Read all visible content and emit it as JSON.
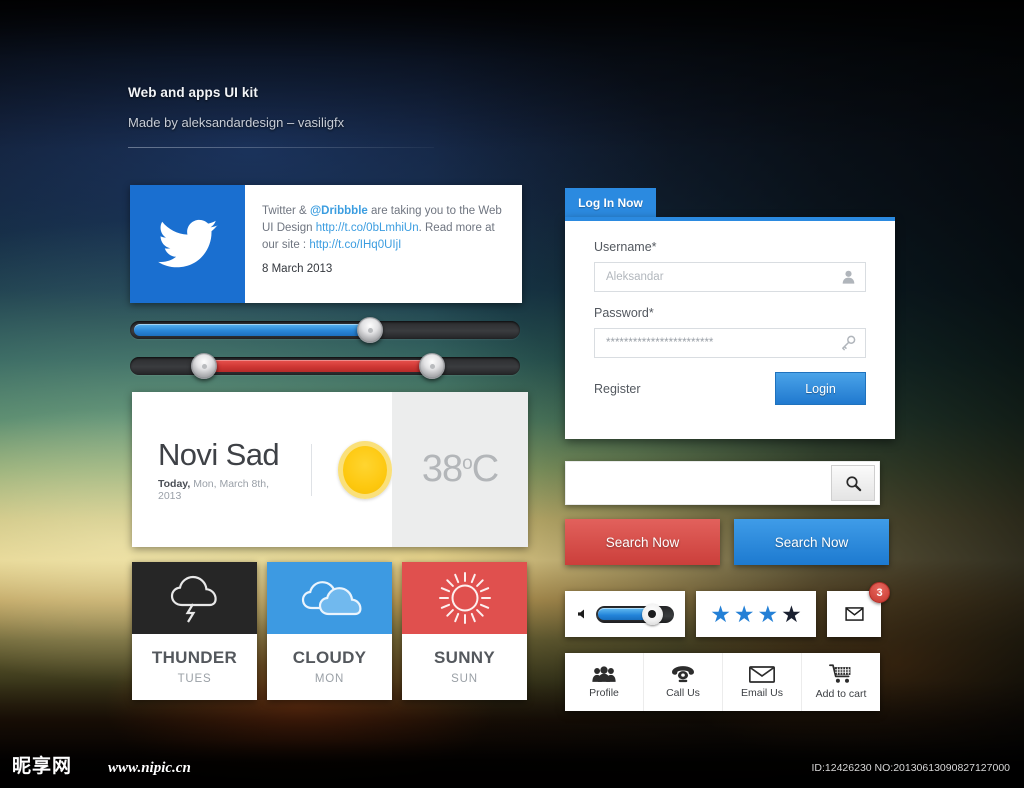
{
  "header": {
    "title": "Web and apps UI kit",
    "subtitle": "Made by aleksandardesign – vasiligfx"
  },
  "twitter_card": {
    "icon": "twitter-bird-icon",
    "brand_color": "#1a6fd0",
    "text_prefix": "Twitter & ",
    "mention": "@Dribbble",
    "text_mid1": " are taking you to the Web UI Design ",
    "link1": "http://t.co/0bLmhiUn",
    "text_mid2": ". Read more at our site : ",
    "link2": "http://t.co/IHq0UIjI",
    "date": "8 March 2013"
  },
  "sliders": [
    {
      "name": "blue-slider",
      "type": "single",
      "fill_color": "#2a87d8",
      "value_percent": 60
    },
    {
      "name": "red-slider",
      "type": "range",
      "fill_color": "#cf3734",
      "start_percent": 19,
      "end_percent": 77
    }
  ],
  "weather_main": {
    "city": "Novi Sad",
    "today_label": "Today,",
    "date": " Mon, March 8th, 2013",
    "icon": "sun-icon",
    "temperature": "38",
    "degree_symbol": "o",
    "unit": "C"
  },
  "weather_tiles": [
    {
      "name": "THUNDER",
      "day": "TUES",
      "icon": "thunder-cloud-icon",
      "color": "#262626"
    },
    {
      "name": "CLOUDY",
      "day": "MON",
      "icon": "cloud-icon",
      "color": "#3d9ae2"
    },
    {
      "name": "SUNNY",
      "day": "SUN",
      "icon": "sun-rays-icon",
      "color": "#e0504e"
    }
  ],
  "login": {
    "tab_label": "Log In Now",
    "accent_color": "#2b8ae0",
    "username_label": "Username*",
    "username_placeholder": "Aleksandar",
    "username_value": "",
    "username_icon": "user-icon",
    "password_label": "Password*",
    "password_value": "************************",
    "password_icon": "key-icon",
    "register_label": "Register",
    "login_button": "Login"
  },
  "search": {
    "input_value": "",
    "input_placeholder": "",
    "button_icon": "magnifier-icon",
    "action_red_label": "Search Now",
    "action_blue_label": "Search Now",
    "red_color": "#cb3f3b",
    "blue_color": "#1d7ad0"
  },
  "widgets": {
    "volume": {
      "icon": "speaker-icon",
      "value_percent": 66
    },
    "rating": {
      "stars_filled": 3,
      "stars_total": 4,
      "filled_color": "#2480d6",
      "empty_color": "#1a2030"
    },
    "mail": {
      "icon": "envelope-icon",
      "badge_count": "3",
      "badge_color": "#c6372f"
    }
  },
  "action_bar": [
    {
      "label": "Profile",
      "icon": "people-icon"
    },
    {
      "label": "Call Us",
      "icon": "phone-icon"
    },
    {
      "label": "Email Us",
      "icon": "envelope-icon"
    },
    {
      "label": "Add to cart",
      "icon": "shopping-cart-icon"
    }
  ],
  "footer": {
    "watermark_cn": "昵享网",
    "watermark_url": "www.nipic.cn",
    "id_text": "ID:12426230 NO:20130613090827127000"
  }
}
